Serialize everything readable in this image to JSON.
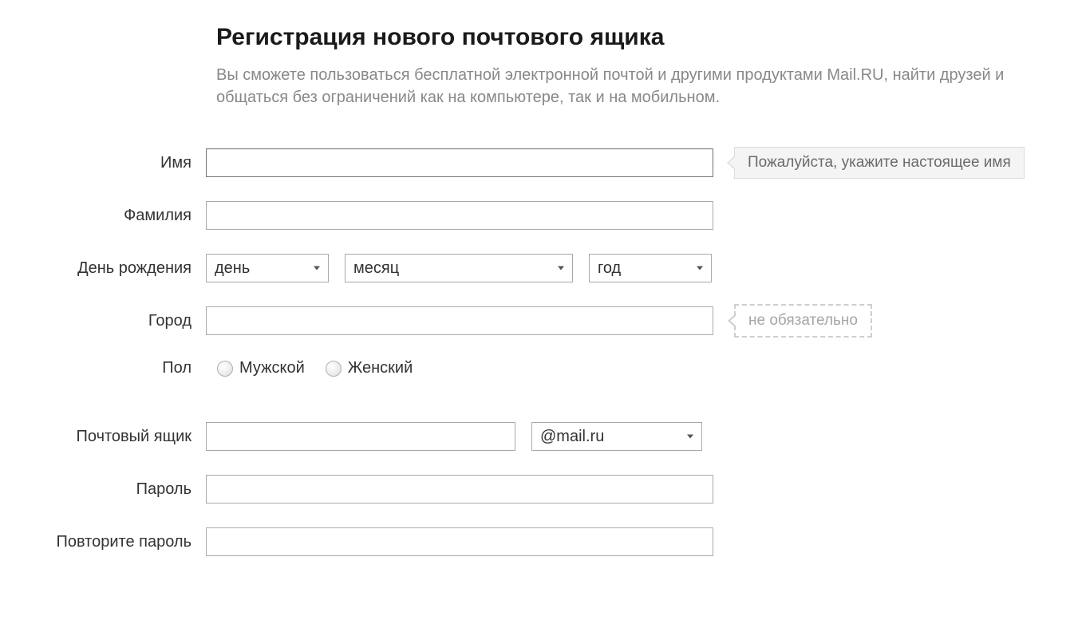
{
  "header": {
    "title": "Регистрация нового почтового ящика",
    "subtitle": "Вы сможете пользоваться бесплатной электронной почтой и другими продуктами Mail.RU, найти друзей и общаться без ограничений как на компьютере, так и на мобильном."
  },
  "labels": {
    "firstname": "Имя",
    "lastname": "Фамилия",
    "birthday": "День рождения",
    "city": "Город",
    "gender": "Пол",
    "mailbox": "Почтовый ящик",
    "password": "Пароль",
    "password_repeat": "Повторите пароль"
  },
  "birthday": {
    "day": "день",
    "month": "месяц",
    "year": "год"
  },
  "tooltips": {
    "firstname": "Пожалуйста, укажите настоящее имя",
    "city_optional": "не обязательно"
  },
  "gender": {
    "male": "Мужской",
    "female": "Женский"
  },
  "mailbox": {
    "domain": "@mail.ru"
  }
}
